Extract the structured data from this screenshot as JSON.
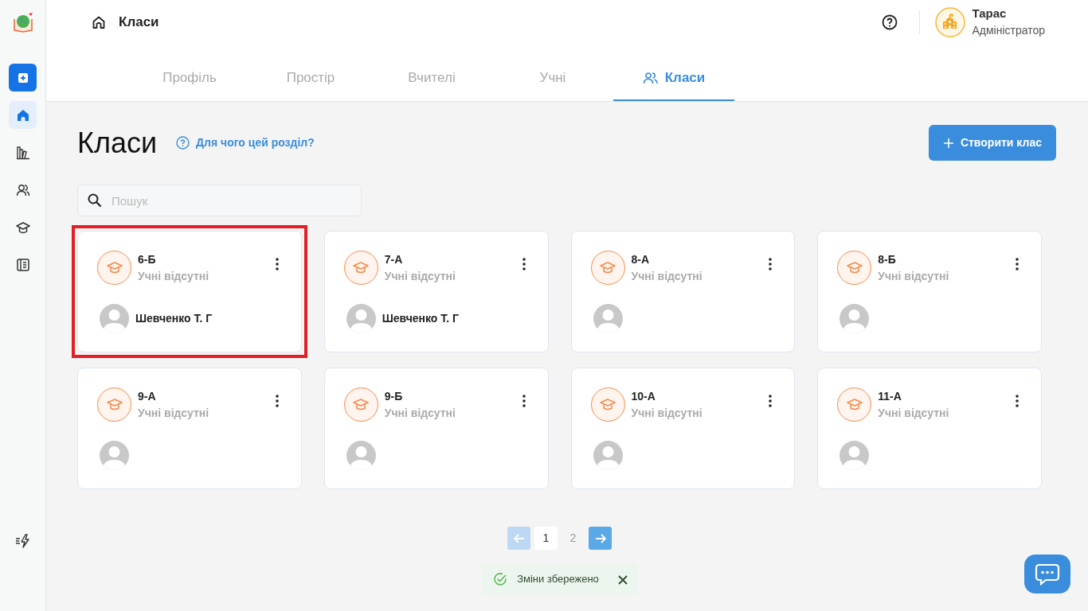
{
  "sidebar": {
    "items": [
      {
        "kind": "home",
        "selected": true
      },
      {
        "kind": "library",
        "selected": false
      },
      {
        "kind": "people",
        "selected": false
      },
      {
        "kind": "cap",
        "selected": false
      },
      {
        "kind": "journal",
        "selected": false
      }
    ]
  },
  "header": {
    "breadcrumb": "Класи",
    "user": {
      "name": "Тарас",
      "role": "Адміністратор"
    }
  },
  "tabs": [
    {
      "label": "Профіль",
      "selected": false
    },
    {
      "label": "Простір",
      "selected": false
    },
    {
      "label": "Вчителі",
      "selected": false
    },
    {
      "label": "Учні",
      "selected": false
    },
    {
      "label": "Класи",
      "selected": true
    }
  ],
  "page": {
    "title": "Класи",
    "help_link": "Для чого цей розділ?",
    "create_button": "Створити клас"
  },
  "search": {
    "placeholder": "Пошук"
  },
  "classes": [
    {
      "name": "6-Б",
      "status": "Учні відсутні",
      "teacher": "Шевченко Т. Г",
      "highlighted": true
    },
    {
      "name": "7-А",
      "status": "Учні відсутні",
      "teacher": "Шевченко Т. Г",
      "highlighted": false
    },
    {
      "name": "8-А",
      "status": "Учні відсутні",
      "highlighted": false
    },
    {
      "name": "8-Б",
      "status": "Учні відсутні",
      "highlighted": false
    },
    {
      "name": "9-А",
      "status": "Учні відсутні",
      "highlighted": false
    },
    {
      "name": "9-Б",
      "status": "Учні відсутні",
      "highlighted": false
    },
    {
      "name": "10-А",
      "status": "Учні відсутні",
      "highlighted": false
    },
    {
      "name": "11-А",
      "status": "Учні відсутні",
      "highlighted": false
    }
  ],
  "pagination": {
    "prev_disabled": true,
    "next_disabled": false,
    "pages": [
      {
        "label": "1",
        "selected": true
      },
      {
        "label": "2",
        "selected": false
      }
    ]
  },
  "toast": {
    "message": "Зміни збережено"
  }
}
